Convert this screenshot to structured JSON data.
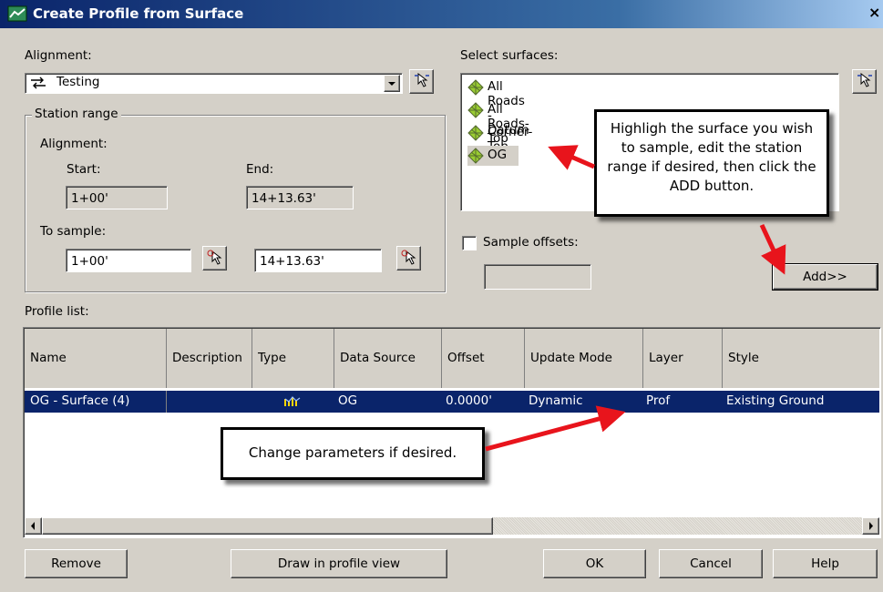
{
  "window": {
    "title": "Create Profile from Surface",
    "close": "×"
  },
  "alignment": {
    "label": "Alignment:",
    "value": "Testing"
  },
  "station_range": {
    "legend": "Station range",
    "alignment_label": "Alignment:",
    "start_label": "Start:",
    "start_value": "1+00'",
    "end_label": "End:",
    "end_value": "14+13.63'",
    "sample_label": "To sample:",
    "sample_start": "1+00'",
    "sample_end": "14+13.63'"
  },
  "surfaces": {
    "label": "Select surfaces:",
    "items": [
      "All Roads - Datum",
      "All Roads-Top",
      "Corner-Top",
      "OG"
    ],
    "selected": "OG"
  },
  "sample_offsets": {
    "label": "Sample offsets:",
    "checked": false,
    "value": ""
  },
  "add_button": "Add>>",
  "profile_list": {
    "label": "Profile list:",
    "columns": [
      "Name",
      "Description",
      "Type",
      "Data Source",
      "Offset",
      "Update Mode",
      "Layer",
      "Style"
    ],
    "rows": [
      {
        "name": "OG - Surface (4)",
        "description": "",
        "type": "profile-icon",
        "data_source": "OG",
        "offset": "0.0000'",
        "update_mode": "Dynamic",
        "layer": "Prof",
        "style": "Existing Ground"
      }
    ]
  },
  "callouts": {
    "surface": "Highligh the surface you wish to sample, edit the station range if desired, then click the ADD button.",
    "params": "Change parameters if desired."
  },
  "buttons": {
    "remove": "Remove",
    "draw": "Draw in profile view",
    "ok": "OK",
    "cancel": "Cancel",
    "help": "Help"
  },
  "colors": {
    "selection": "#0a246a",
    "dialog": "#d4d0c8",
    "arrow": "#e8141c"
  }
}
